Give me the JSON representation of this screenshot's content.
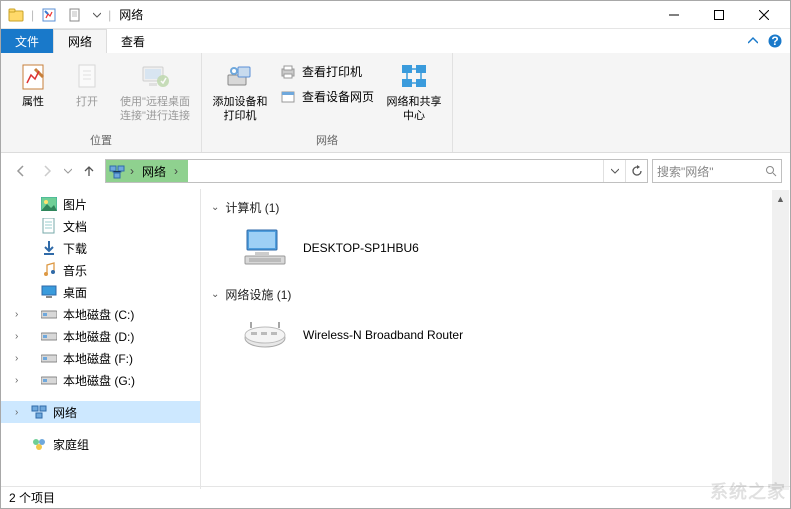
{
  "window": {
    "title": "网络",
    "qat_sep": "|"
  },
  "ribbon": {
    "tabs": {
      "file": "文件",
      "network": "网络",
      "view": "查看"
    },
    "groups": {
      "location": {
        "label": "位置",
        "properties": "属性",
        "open": "打开",
        "rdp": "使用\"远程桌面连接\"进行连接"
      },
      "network": {
        "label": "网络",
        "add_device": "添加设备和打印机",
        "view_printers": "查看打印机",
        "view_device_page": "查看设备网页",
        "center": "网络和共享中心"
      }
    }
  },
  "addressbar": {
    "crumb_root": "网络",
    "search_placeholder": "搜索\"网络\""
  },
  "tree": {
    "items": [
      {
        "label": "图片",
        "icon": "picture-icon"
      },
      {
        "label": "文档",
        "icon": "document-icon"
      },
      {
        "label": "下载",
        "icon": "download-icon"
      },
      {
        "label": "音乐",
        "icon": "music-icon"
      },
      {
        "label": "桌面",
        "icon": "desktop-icon"
      },
      {
        "label": "本地磁盘 (C:)",
        "icon": "drive-icon"
      },
      {
        "label": "本地磁盘 (D:)",
        "icon": "drive-icon"
      },
      {
        "label": "本地磁盘 (F:)",
        "icon": "drive-icon"
      },
      {
        "label": "本地磁盘 (G:)",
        "icon": "drive-icon"
      }
    ],
    "network": "网络",
    "homegroup": "家庭组"
  },
  "content": {
    "group_computer": "计算机 (1)",
    "computer_name": "DESKTOP-SP1HBU6",
    "group_infra": "网络设施 (1)",
    "router_name": "Wireless-N Broadband Router"
  },
  "statusbar": {
    "items": "2 个项目"
  },
  "watermark": "系统之家"
}
